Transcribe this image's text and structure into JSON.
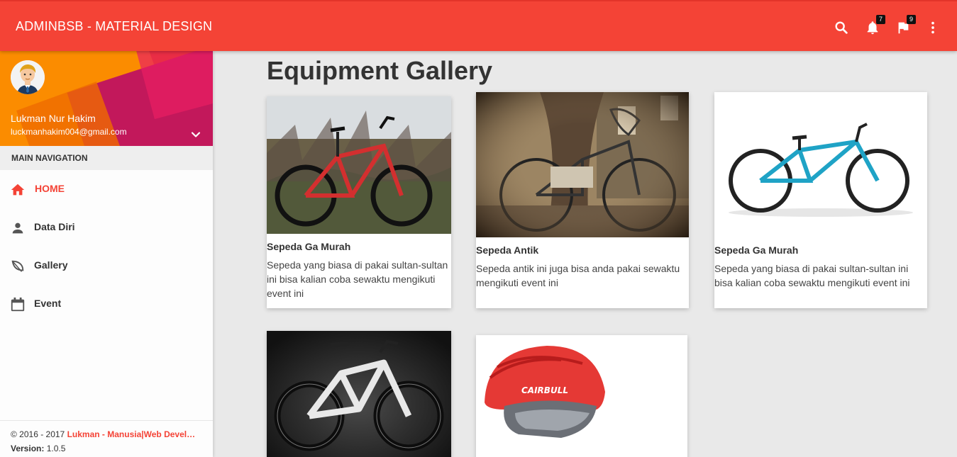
{
  "navbar": {
    "brand": "ADMINBSB - MATERIAL DESIGN",
    "icons": [
      "search-icon",
      "notifications-icon",
      "flag-icon",
      "more-vert-icon"
    ],
    "notifications_count": "7",
    "flags_count": "9",
    "color": "#f44336"
  },
  "user": {
    "name": "Lukman Nur Hakim",
    "email": "luckmanhakim004@gmail.com"
  },
  "menu": {
    "header": "MAIN NAVIGATION",
    "items": [
      {
        "label": "HOME",
        "icon": "home-icon",
        "active": true
      },
      {
        "label": "Data Diri",
        "icon": "person-icon"
      },
      {
        "label": "Gallery",
        "icon": "leaf-icon"
      },
      {
        "label": "Event",
        "icon": "calendar-icon"
      }
    ]
  },
  "legal": {
    "copyright": "© 2016 - 2017 ",
    "link": "Lukman - Manusia|Web Devel…",
    "version_label": "Version:",
    "version": " 1.0.5"
  },
  "page": {
    "title": "Equipment Gallery"
  },
  "gallery": [
    {
      "title": "Sepeda Ga Murah",
      "text": "Sepeda yang biasa di pakai sultan-sultan ini bisa kalian coba sewaktu mengikuti event ini"
    },
    {
      "title": "Sepeda Antik",
      "text": "Sepeda antik ini juga bisa anda pakai sewaktu mengikuti event ini"
    },
    {
      "title": "Sepeda Ga Murah",
      "text": "Sepeda yang biasa di pakai sultan-sultan ini bisa kalian coba sewaktu mengikuti event ini"
    },
    {
      "title": "",
      "text": ""
    },
    {
      "title": "",
      "text": ""
    }
  ]
}
